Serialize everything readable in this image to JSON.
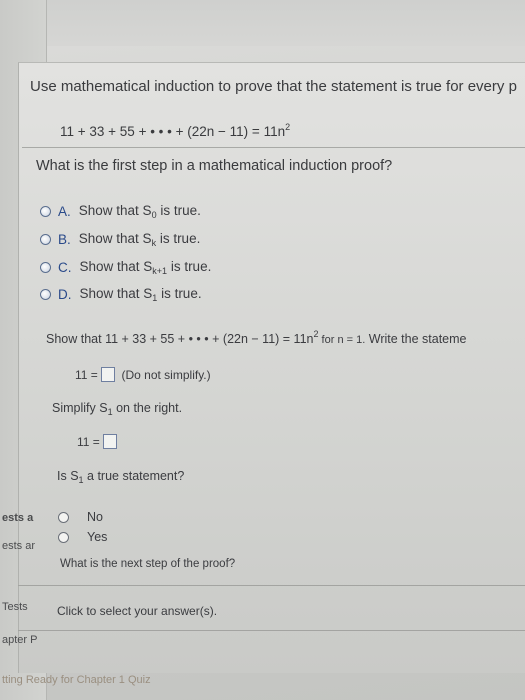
{
  "question": {
    "intro": "Use mathematical induction to prove that the statement is true for every p",
    "statement": "11 + 33 + 55 + • • • + (22n − 11) = 11n",
    "exp": "2"
  },
  "part1": {
    "prompt": "What is the first step in a mathematical induction proof?",
    "options": [
      {
        "letter": "A.",
        "pre": "Show that S",
        "sub": "0",
        "post": " is true."
      },
      {
        "letter": "B.",
        "pre": "Show that S",
        "sub": "k",
        "post": " is true."
      },
      {
        "letter": "C.",
        "pre": "Show that S",
        "sub": "k+1",
        "post": " is true."
      },
      {
        "letter": "D.",
        "pre": "Show that S",
        "sub": "1",
        "post": " is true."
      }
    ]
  },
  "part2": {
    "line_pre": "Show that 11 + 33 + 55 + • • • + (22n − 11) = 11n",
    "line_exp": "2",
    "line_mid": " for n = 1.",
    "line_post": " Write the stateme",
    "eq_left": "11 =",
    "hint": "(Do not simplify.)",
    "simplify_pre": "Simplify S",
    "simplify_sub": "1",
    "simplify_post": " on the right.",
    "eq2_left": "11 =",
    "true_pre": "Is S",
    "true_sub": "1",
    "true_post": " a true statement?",
    "choices": [
      "No",
      "Yes"
    ],
    "next_prompt": "What is the next step of the proof?",
    "click_label": "Click to select your answer(s)."
  },
  "sidebar": {
    "item1": "ests a",
    "item2": "ests ar",
    "item3": "Tests",
    "item4": "apter P",
    "footer": "tting Ready for Chapter 1 Quiz"
  }
}
